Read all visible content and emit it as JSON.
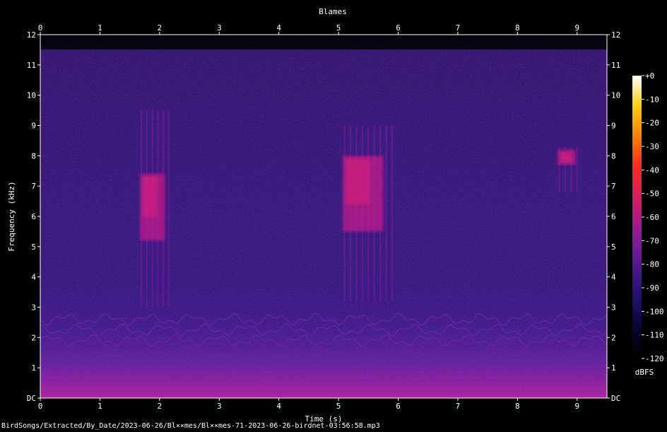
{
  "chart_data": {
    "type": "heatmap",
    "title": "Blames",
    "xlabel": "Time (s)",
    "ylabel": "Frequency (kHz)",
    "x_ticks": [
      "0",
      "1",
      "2",
      "3",
      "4",
      "5",
      "6",
      "7",
      "8",
      "9"
    ],
    "y_ticks": [
      "DC",
      "1",
      "2",
      "3",
      "4",
      "5",
      "6",
      "7",
      "8",
      "9",
      "10",
      "11",
      "12"
    ],
    "xlim": [
      0,
      9.5
    ],
    "ylim": [
      0,
      12
    ],
    "colorbar": {
      "label": "dBFS",
      "ticks": [
        "+0",
        "-10",
        "-20",
        "-30",
        "-40",
        "-50",
        "-60",
        "-70",
        "-80",
        "-90",
        "-100",
        "-110",
        "-120"
      ],
      "range": [
        -120,
        0
      ]
    },
    "noise_floor_khz": 2.5,
    "calls": [
      {
        "t_start": 1.65,
        "t_end": 2.2,
        "f_low_khz": 3.0,
        "f_high_khz": 9.5,
        "peak_f_low_khz": 5.2,
        "peak_f_high_khz": 7.4
      },
      {
        "t_start": 5.05,
        "t_end": 5.95,
        "f_low_khz": 3.2,
        "f_high_khz": 9.0,
        "peak_f_low_khz": 5.5,
        "peak_f_high_khz": 8.0
      },
      {
        "t_start": 8.65,
        "t_end": 9.05,
        "f_low_khz": 6.8,
        "f_high_khz": 8.3,
        "peak_f_low_khz": 7.7,
        "peak_f_high_khz": 8.2
      }
    ],
    "grid": false,
    "legend": "colorbar-right"
  },
  "footer": {
    "filename": "BirdSongs/Extracted/By_Date/2023-06-26/Bl××mes/Bl××mes-71-2023-06-26-birdnet-03:56:58.mp3"
  }
}
